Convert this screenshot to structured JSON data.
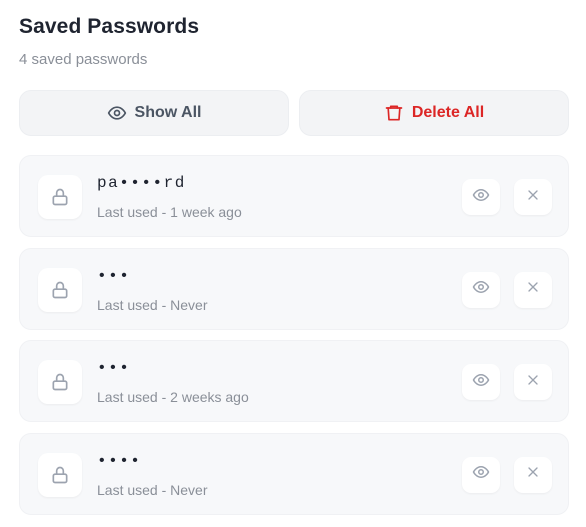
{
  "header": {
    "title": "Saved Passwords",
    "subtitle": "4 saved passwords"
  },
  "actions": {
    "show_all_label": "Show All",
    "delete_all_label": "Delete All"
  },
  "passwords": [
    {
      "masked": "pa••••rd",
      "last_used": "Last used - 1 week ago"
    },
    {
      "masked": "•••",
      "last_used": "Last used - Never"
    },
    {
      "masked": "•••",
      "last_used": "Last used - 2 weeks ago"
    },
    {
      "masked": "••••",
      "last_used": "Last used - Never"
    }
  ],
  "colors": {
    "danger": "#dc2626",
    "muted_text": "#8a8f98",
    "card_bg": "#f7f8fa"
  },
  "icons": {
    "show_all": "eye-icon",
    "delete_all": "trash-icon",
    "item_lead": "lock-icon",
    "item_reveal": "eye-icon",
    "item_remove": "close-icon"
  }
}
